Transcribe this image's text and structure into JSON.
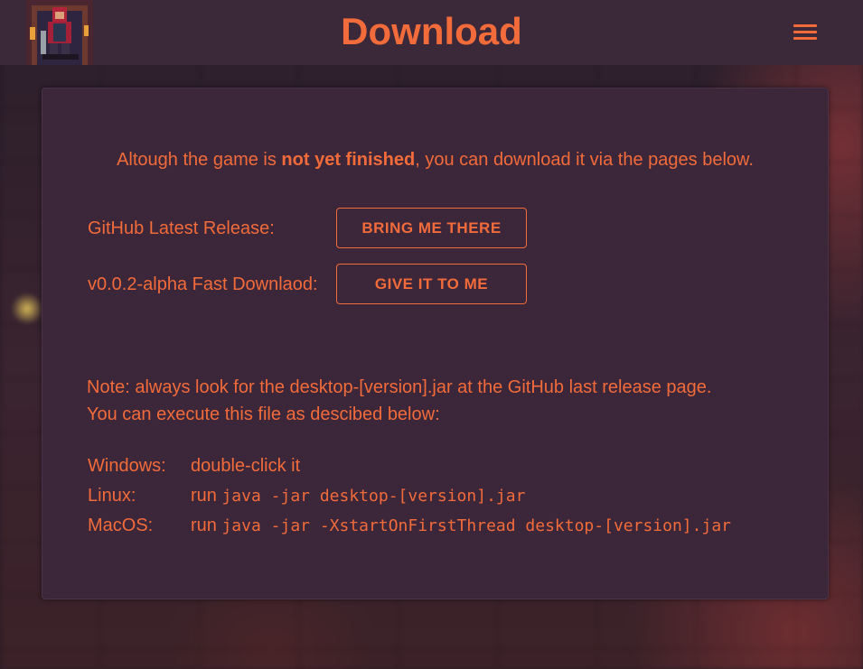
{
  "header": {
    "title": "Download",
    "logo": "pixel-art-hero-logo",
    "menu_icon": "hamburger-menu-icon"
  },
  "intro": {
    "before": "Altough the game is ",
    "bold": "not yet finished",
    "after": ", you can download it via the pages below."
  },
  "downloads": [
    {
      "label": "GitHub Latest Release:",
      "button": "BRING ME THERE"
    },
    {
      "label": "v0.0.2-alpha Fast Downlaod:",
      "button": "GIVE IT TO ME"
    }
  ],
  "note": {
    "line1": "Note: always look for the desktop-[version].jar at the GitHub last release page.",
    "line2": "You can execute this file as descibed below:"
  },
  "instructions": [
    {
      "os": "Windows:",
      "prefix": "double-click it",
      "command": ""
    },
    {
      "os": "Linux:",
      "prefix": "run ",
      "command": "java -jar desktop-[version].jar"
    },
    {
      "os": "MacOS:",
      "prefix": "run ",
      "command": "java -jar -XstartOnFirstThread desktop-[version].jar"
    }
  ],
  "colors": {
    "accent": "#f26b3a",
    "header_bg": "#3b2839",
    "card_bg": "#3c2639"
  }
}
